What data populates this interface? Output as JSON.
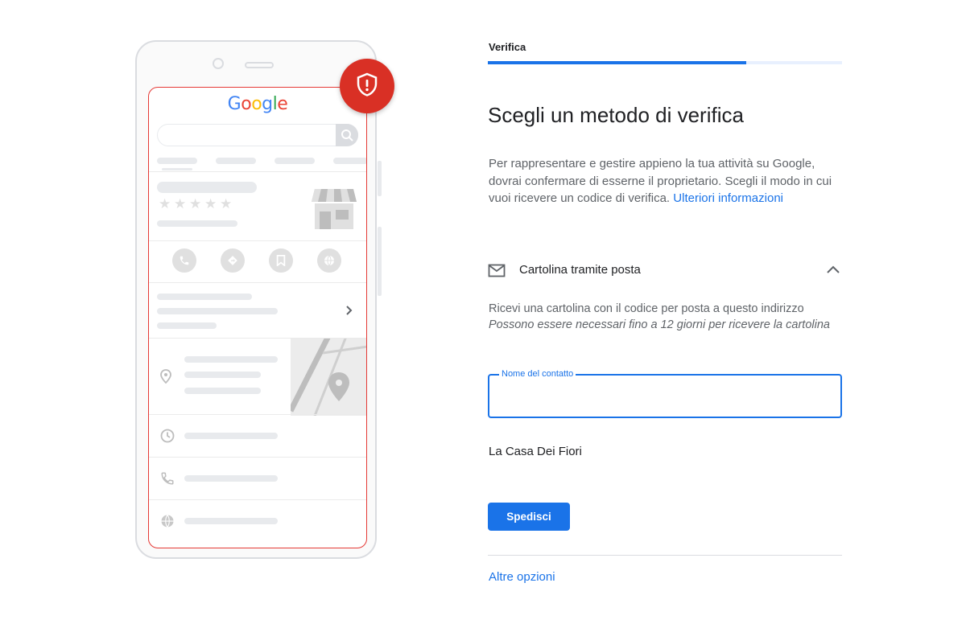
{
  "illustration": {
    "logo_letters": [
      {
        "char": "G",
        "color": "#4285F4"
      },
      {
        "char": "o",
        "color": "#EA4335"
      },
      {
        "char": "o",
        "color": "#FBBC05"
      },
      {
        "char": "g",
        "color": "#4285F4"
      },
      {
        "char": "l",
        "color": "#34A853"
      },
      {
        "char": "e",
        "color": "#EA4335"
      }
    ],
    "stars": [
      "★",
      "★",
      "★",
      "★",
      "★"
    ],
    "badge_color": "#D93025"
  },
  "verification": {
    "step_label": "Verifica",
    "progress": 0.73,
    "title": "Scegli un metodo di verifica",
    "description": "Per rappresentare e gestire appieno la tua attività su Google, dovrai confermare di esserne il proprietario. Scegli il modo in cui vuoi ricevere un codice di verifica.",
    "learn_more_link": "Ulteriori informazioni",
    "method": {
      "icon": "mail-icon",
      "label": "Cartolina tramite posta",
      "expanded_icon": "chevron-up-icon",
      "info_line": "Ricevi una cartolina con il codice per posta a questo indirizzo",
      "info_note": "Possono essere necessari fino a 12 giorni per ricevere la cartolina"
    },
    "contact_field": {
      "label": "Nome del contatto",
      "value": ""
    },
    "business_name": "La Casa Dei Fiori",
    "send_button": "Spedisci",
    "more_options": "Altre opzioni"
  },
  "colors": {
    "accent": "#1A73E8",
    "badge": "#D93025"
  }
}
